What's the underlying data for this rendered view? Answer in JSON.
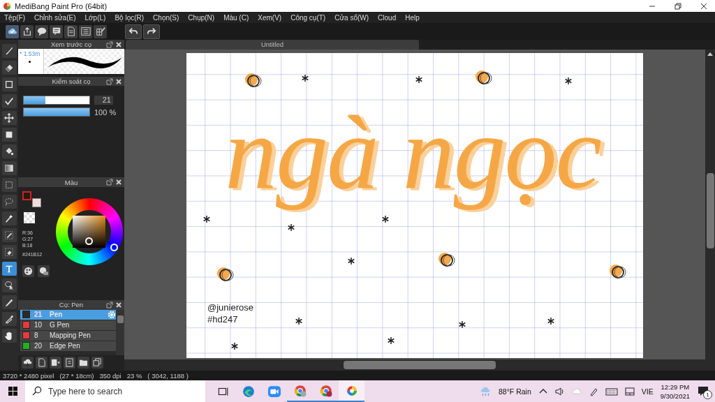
{
  "window": {
    "title": "MediBang Paint Pro (64bit)"
  },
  "menu": [
    "Tệp(F)",
    "Chỉnh sửa(E)",
    "Lớp(L)",
    "Bộ lọc(R)",
    "Chọn(S)",
    "Chụp(N)",
    "Màu (C)",
    "Xem(V)",
    "Công cụ(T)",
    "Cửa sổ(W)",
    "Cloud",
    "Help"
  ],
  "tools": [
    {
      "selected": false
    },
    {
      "selected": false
    },
    {
      "selected": false
    },
    {
      "selected": false
    },
    {
      "selected": false
    },
    {
      "selected": false
    },
    {
      "selected": false
    },
    {
      "selected": false
    },
    {
      "selected": false
    },
    {
      "selected": false
    },
    {
      "selected": false
    },
    {
      "selected": false
    },
    {
      "selected": false
    },
    {
      "selected": true
    },
    {
      "selected": false
    },
    {
      "selected": false
    },
    {
      "selected": false
    },
    {
      "selected": false
    }
  ],
  "brush_preview": {
    "title": "Xem trước cọ",
    "size": "* 1.53m"
  },
  "brush_control": {
    "title": "Kiểm soát cọ",
    "size": {
      "level": 0.33,
      "value": "21"
    },
    "opacity": {
      "level": 1,
      "reading": "100 %"
    }
  },
  "color": {
    "title": "Màu",
    "rgb": [
      "R:36",
      "G:27",
      "B:18"
    ],
    "hex": "#241B12"
  },
  "brushes": {
    "title": "Cọ: Pen",
    "items": [
      {
        "size": "21",
        "name": "Pen",
        "color": "#2a2a2a",
        "selected": true
      },
      {
        "size": "10",
        "name": "G Pen",
        "color": "#e83a3a",
        "selected": false
      },
      {
        "size": "8",
        "name": "Mapping Pen",
        "color": "#e83a3a",
        "selected": false
      },
      {
        "size": "20",
        "name": "Edge Pen",
        "color": "#22b022",
        "selected": false
      }
    ]
  },
  "document": {
    "tab": "Untitled",
    "lettering": "ngà ngọc",
    "signature": [
      "@junierose",
      "#hd247"
    ]
  },
  "status_bar": [
    "3720 * 2480 pixel",
    "(27 * 18cm)",
    "350 dpi",
    "23 %",
    "( 3042, 1188 )"
  ],
  "taskbar": {
    "search": {
      "placeholder": "Type here to search"
    },
    "apps": [
      {
        "running": false,
        "selected": false
      },
      {
        "running": false,
        "selected": false
      },
      {
        "running": false,
        "selected": false
      },
      {
        "running": true,
        "selected": false
      },
      {
        "running": true,
        "selected": false
      },
      {
        "running": true,
        "selected": true
      }
    ],
    "weather": "88°F Rain",
    "language": "VIE",
    "time": "12:29 PM",
    "date": "9/30/2021",
    "notifications": "1"
  }
}
